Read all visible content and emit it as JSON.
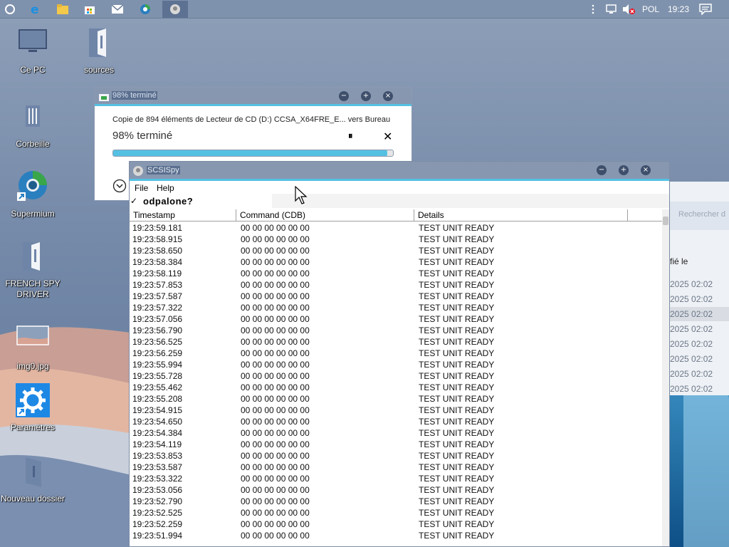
{
  "taskbar": {
    "icons": [
      "cortana-icon",
      "edge-icon",
      "file-explorer-icon",
      "store-icon",
      "mail-icon",
      "supermium-icon",
      "scsispy-taskbar-icon"
    ],
    "language": "POL",
    "time": "19:23"
  },
  "desktop": {
    "icons": [
      {
        "label": "Ce PC"
      },
      {
        "label": "sources"
      },
      {
        "label": "Corbeille"
      },
      {
        "label": "Supermium"
      },
      {
        "label": "FRENCH SPY DRIVER"
      },
      {
        "label": "img0.jpg"
      },
      {
        "label": "Paramètres"
      },
      {
        "label": "Nouveau dossier"
      }
    ]
  },
  "copy_dialog": {
    "title": "98% terminé",
    "description": "Copie de 894 éléments de Lecteur de CD (D:) CCSA_X64FRE_E... vers Bureau",
    "percent_text": "98% terminé",
    "progress": 0.98
  },
  "scsispy": {
    "title": "SCSISpy",
    "menu": {
      "file": "File",
      "help": "Help"
    },
    "checkbox_label": "odpalone?",
    "columns": [
      "Timestamp",
      "Command (CDB)",
      "Details"
    ],
    "rows": [
      {
        "ts": "19:23:59.181",
        "cdb": "00 00 00 00 00 00",
        "details": "TEST UNIT READY"
      },
      {
        "ts": "19:23:58.915",
        "cdb": "00 00 00 00 00 00",
        "details": "TEST UNIT READY"
      },
      {
        "ts": "19:23:58.650",
        "cdb": "00 00 00 00 00 00",
        "details": "TEST UNIT READY"
      },
      {
        "ts": "19:23:58.384",
        "cdb": "00 00 00 00 00 00",
        "details": "TEST UNIT READY"
      },
      {
        "ts": "19:23:58.119",
        "cdb": "00 00 00 00 00 00",
        "details": "TEST UNIT READY"
      },
      {
        "ts": "19:23:57.853",
        "cdb": "00 00 00 00 00 00",
        "details": "TEST UNIT READY"
      },
      {
        "ts": "19:23:57.587",
        "cdb": "00 00 00 00 00 00",
        "details": "TEST UNIT READY"
      },
      {
        "ts": "19:23:57.322",
        "cdb": "00 00 00 00 00 00",
        "details": "TEST UNIT READY"
      },
      {
        "ts": "19:23:57.056",
        "cdb": "00 00 00 00 00 00",
        "details": "TEST UNIT READY"
      },
      {
        "ts": "19:23:56.790",
        "cdb": "00 00 00 00 00 00",
        "details": "TEST UNIT READY"
      },
      {
        "ts": "19:23:56.525",
        "cdb": "00 00 00 00 00 00",
        "details": "TEST UNIT READY"
      },
      {
        "ts": "19:23:56.259",
        "cdb": "00 00 00 00 00 00",
        "details": "TEST UNIT READY"
      },
      {
        "ts": "19:23:55.994",
        "cdb": "00 00 00 00 00 00",
        "details": "TEST UNIT READY"
      },
      {
        "ts": "19:23:55.728",
        "cdb": "00 00 00 00 00 00",
        "details": "TEST UNIT READY"
      },
      {
        "ts": "19:23:55.462",
        "cdb": "00 00 00 00 00 00",
        "details": "TEST UNIT READY"
      },
      {
        "ts": "19:23:55.208",
        "cdb": "00 00 00 00 00 00",
        "details": "TEST UNIT READY"
      },
      {
        "ts": "19:23:54.915",
        "cdb": "00 00 00 00 00 00",
        "details": "TEST UNIT READY"
      },
      {
        "ts": "19:23:54.650",
        "cdb": "00 00 00 00 00 00",
        "details": "TEST UNIT READY"
      },
      {
        "ts": "19:23:54.384",
        "cdb": "00 00 00 00 00 00",
        "details": "TEST UNIT READY"
      },
      {
        "ts": "19:23:54.119",
        "cdb": "00 00 00 00 00 00",
        "details": "TEST UNIT READY"
      },
      {
        "ts": "19:23:53.853",
        "cdb": "00 00 00 00 00 00",
        "details": "TEST UNIT READY"
      },
      {
        "ts": "19:23:53.587",
        "cdb": "00 00 00 00 00 00",
        "details": "TEST UNIT READY"
      },
      {
        "ts": "19:23:53.322",
        "cdb": "00 00 00 00 00 00",
        "details": "TEST UNIT READY"
      },
      {
        "ts": "19:23:53.056",
        "cdb": "00 00 00 00 00 00",
        "details": "TEST UNIT READY"
      },
      {
        "ts": "19:23:52.790",
        "cdb": "00 00 00 00 00 00",
        "details": "TEST UNIT READY"
      },
      {
        "ts": "19:23:52.525",
        "cdb": "00 00 00 00 00 00",
        "details": "TEST UNIT READY"
      },
      {
        "ts": "19:23:52.259",
        "cdb": "00 00 00 00 00 00",
        "details": "TEST UNIT READY"
      },
      {
        "ts": "19:23:51.994",
        "cdb": "00 00 00 00 00 00",
        "details": "TEST UNIT READY"
      }
    ]
  },
  "explorer_fragment": {
    "search_text": "Rechercher d",
    "column_header": "fié le",
    "dates": [
      "2025 02:02",
      "2025 02:02",
      "2025 02:02",
      "2025 02:02",
      "2025 02:02",
      "2025 02:02",
      "2025 02:02",
      "2025 02:02"
    ]
  },
  "colors": {
    "accent": "#54c1e3",
    "titlebar": "#8797b0",
    "taskbar": "#7f92ad",
    "progress": "#54c1e3"
  }
}
